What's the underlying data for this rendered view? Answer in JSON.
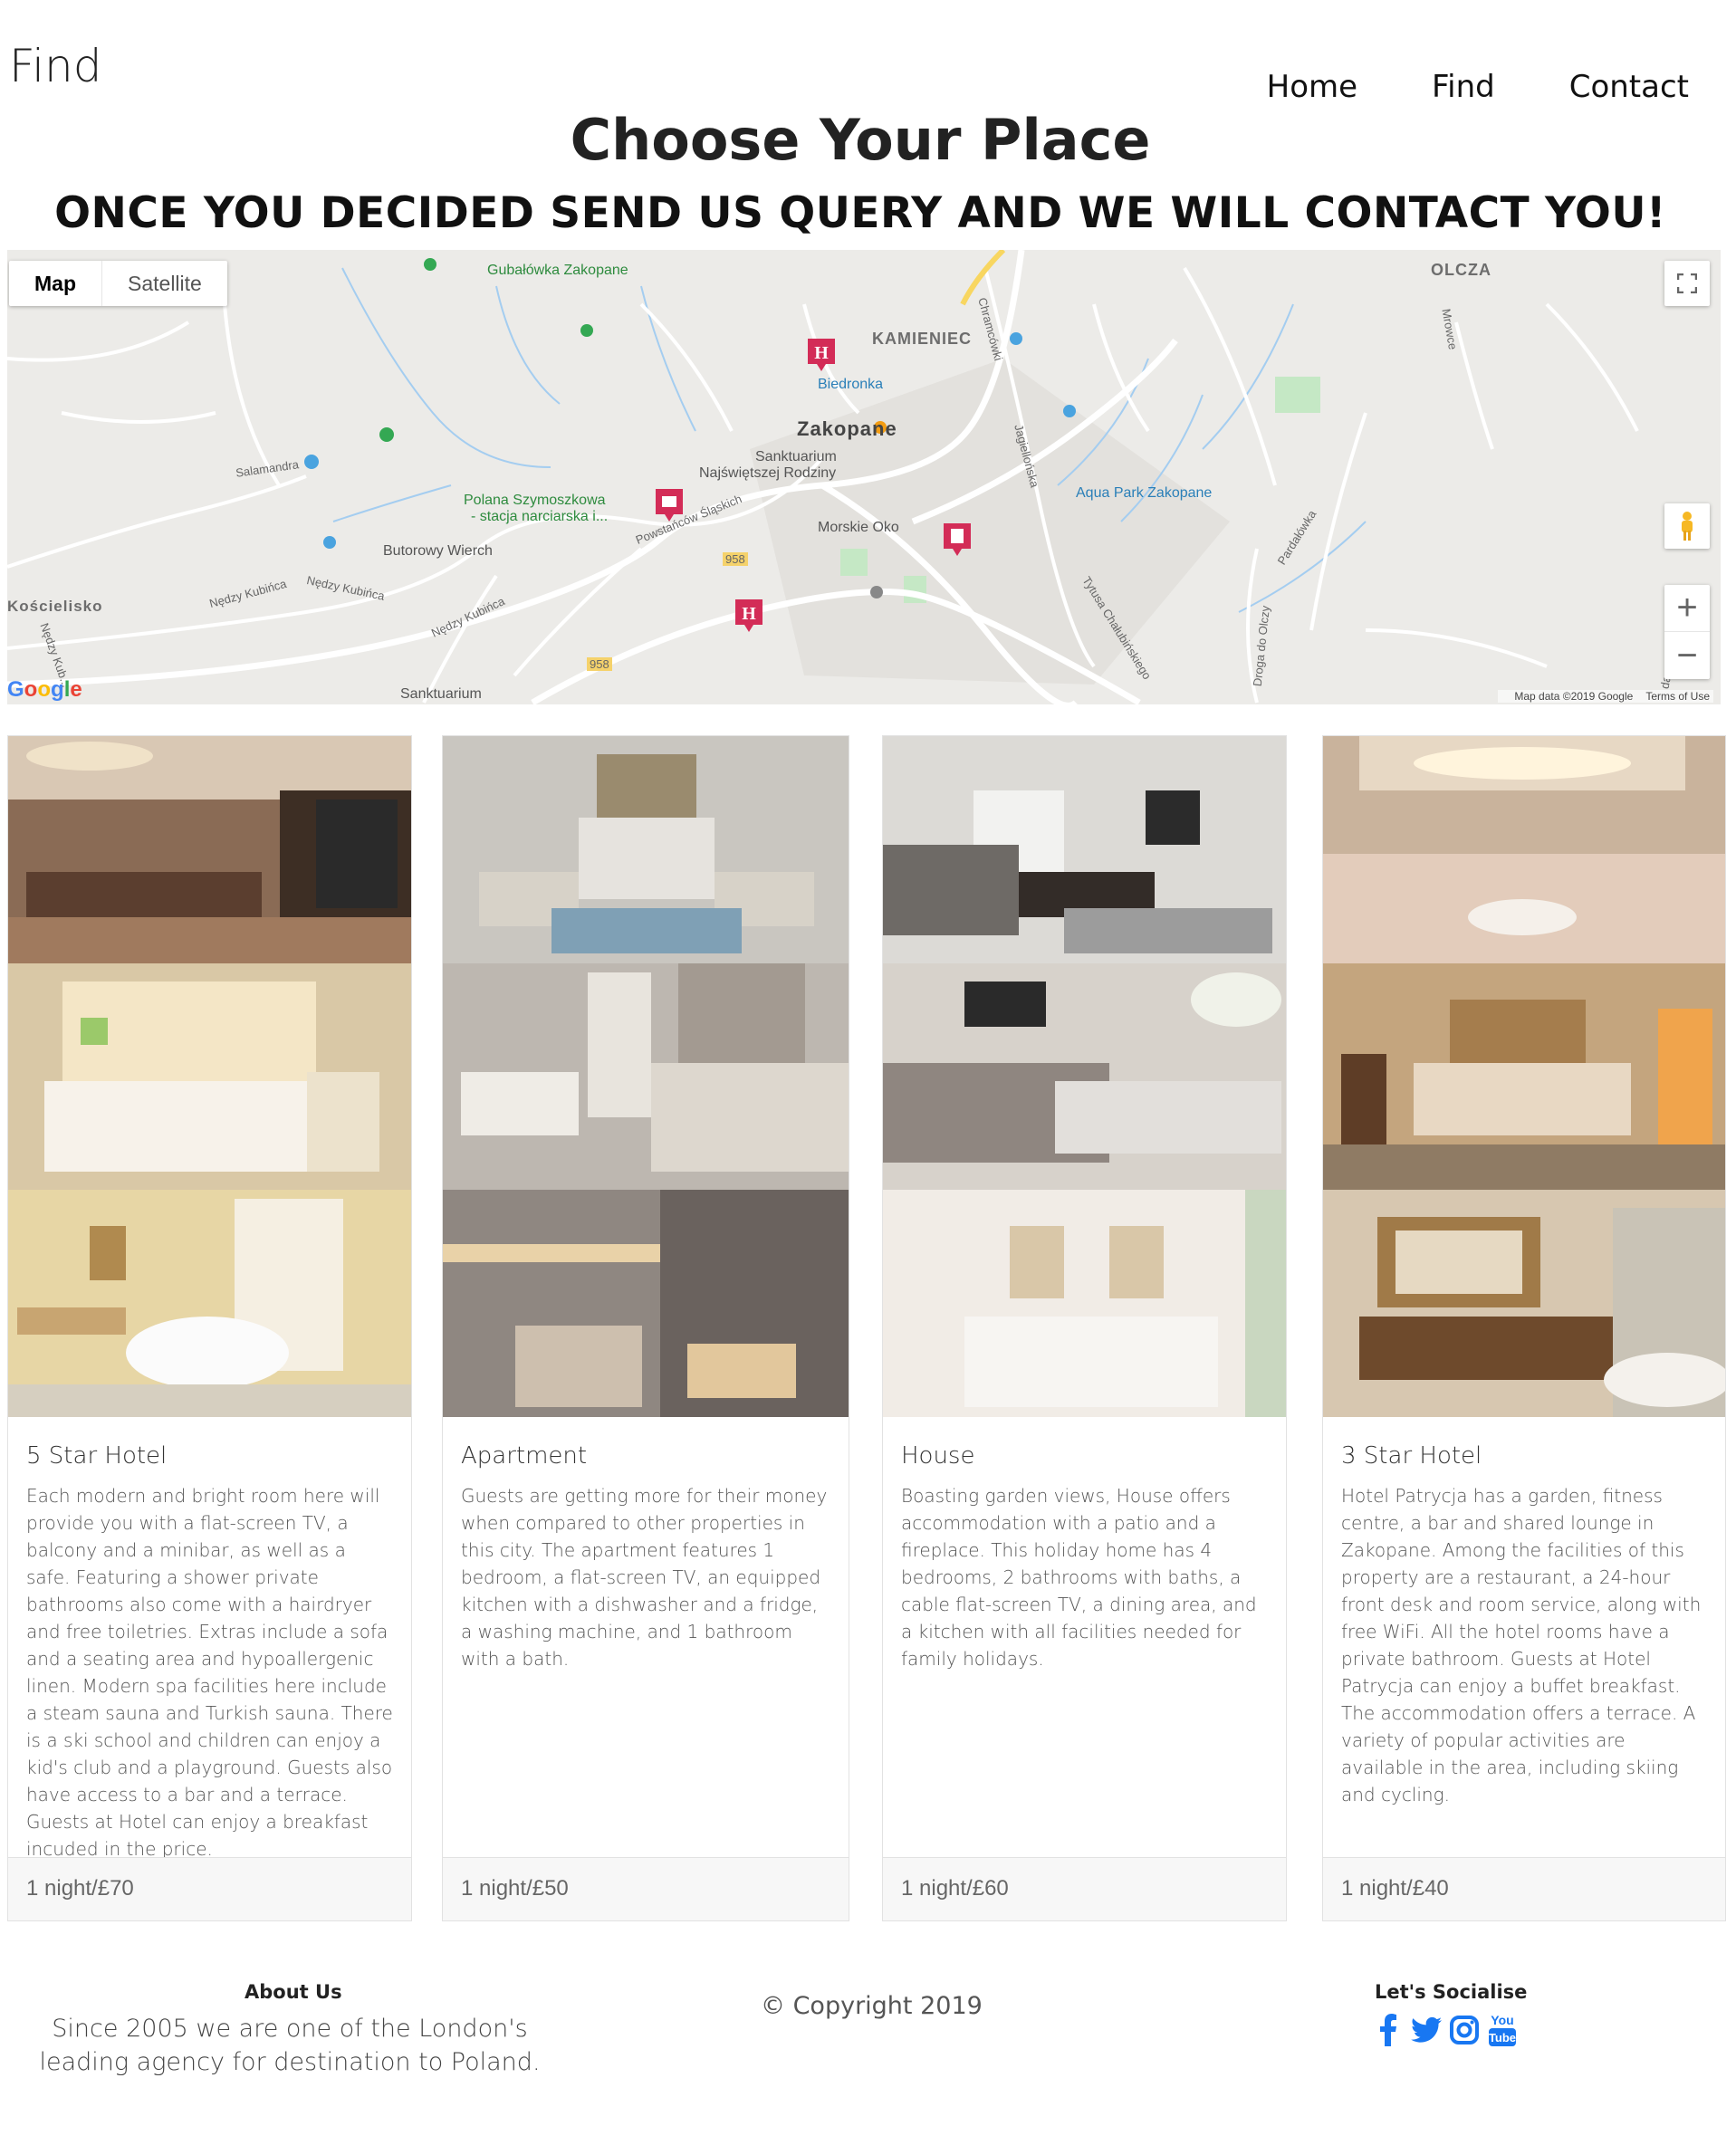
{
  "header": {
    "brand": "Find",
    "nav": [
      "Home",
      "Find",
      "Contact"
    ]
  },
  "hero": {
    "title": "Choose Your Place",
    "subtitle": "ONCE YOU DECIDED SEND US QUERY AND WE WILL CONTACT YOU!"
  },
  "map": {
    "type_buttons": [
      "Map",
      "Satellite"
    ],
    "active_type": "Map",
    "labels": {
      "gubalowka": "Gubałówka Zakopane",
      "olcza": "OLCZA",
      "kamieniec": "KAMIENIEC",
      "biedronka": "Biedronka",
      "zakopane": "Zakopane",
      "sanktuarium1": "Sanktuarium",
      "sanktuarium1b": "Najświętszej Rodziny",
      "salamandra": "Salamandra",
      "polana1": "Polana Szymoszkowa",
      "polana2": "- stacja narciarska i...",
      "powstancow": "Powstańców Śląskich",
      "morskie": "Morskie Oko",
      "aqua": "Aqua Park Zakopane",
      "butorowy": "Butorowy Wierch",
      "koscielisko": "Kościelisko",
      "nedzy1": "Nędzy Kubińca",
      "nedzy2": "Nędzy Kubińca",
      "nedzy3": "Nędzy Kubińca",
      "nedzy4": "Nędzy Kub...",
      "sanktuarium2": "Sanktuarium",
      "chramcowki": "Chramcówki",
      "jagiellonska": "Jagiellońska",
      "chalubinskiego": "Tytusa Chałubińskiego",
      "droga": "Droga do Olczy",
      "pardalowka": "Pardałówka",
      "mrowce": "Mrowce",
      "r958a": "958",
      "r958b": "958",
      "da": "da"
    },
    "logo": "Google",
    "attribution": "Map data ©2019 Google",
    "terms": "Terms of Use",
    "zoom_in": "+",
    "zoom_out": "−",
    "colors": {
      "marker": "#d32c57",
      "road": "#ffffff",
      "water": "#a4cdf0",
      "park": "#c5e8c5",
      "land": "#ecebe8"
    }
  },
  "cards": [
    {
      "title": "5 Star Hotel",
      "description": "Each modern and bright room here will provide you with a flat-screen TV, a balcony and a minibar, as well as a safe. Featuring a shower private bathrooms also come with a hairdryer and free toiletries. Extras include a sofa and a seating area and hypoallergenic linen. Modern spa facilities here include a steam sauna and Turkish sauna. There is a ski school and children can enjoy a kid's club and a playground. Guests also have access to a bar and a terrace. Guests at Hotel can enjoy a breakfast incuded in the price.",
      "price": "1 night/£70",
      "photos": [
        "living-room",
        "bedroom",
        "bathroom"
      ]
    },
    {
      "title": "Apartment",
      "description": "Guests are getting more for their money when compared to other properties in this city. The apartment features 1 bedroom, a flat-screen TV, an equipped kitchen with a dishwasher and a fridge, a washing machine, and 1 bathroom with a bath.",
      "price": "1 night/£50",
      "photos": [
        "living-room",
        "bedroom",
        "bathroom"
      ]
    },
    {
      "title": "House",
      "description": "Boasting garden views, House offers accommodation with a patio and a fireplace. This holiday home has 4 bedrooms, 2 bathrooms with baths, a cable flat-screen TV, a dining area, and a kitchen with all facilities needed for family holidays.",
      "price": "1 night/£60",
      "photos": [
        "living-room",
        "bedroom",
        "bathroom"
      ]
    },
    {
      "title": "3 Star Hotel",
      "description": "Hotel Patrycja has a garden, fitness centre, a bar and shared lounge in Zakopane. Among the facilities of this property are a restaurant, a 24-hour front desk and room service, along with free WiFi. All the hotel rooms have a private bathroom. Guests at Hotel Patrycja can enjoy a buffet breakfast. The accommodation offers a terrace. A variety of popular activities are available in the area, including skiing and cycling.",
      "price": "1 night/£40",
      "photos": [
        "dining-room",
        "bedroom",
        "bathroom"
      ]
    }
  ],
  "footer": {
    "about_heading": "About Us",
    "about_text": "Since 2005 we are one of the London's leading agency for destination to Poland.",
    "copyright": "© Copyright 2019",
    "social_heading": "Let's Socialise",
    "social_icons": [
      "facebook-icon",
      "twitter-icon",
      "instagram-icon",
      "youtube-icon"
    ],
    "social_color": "#1877f2"
  }
}
